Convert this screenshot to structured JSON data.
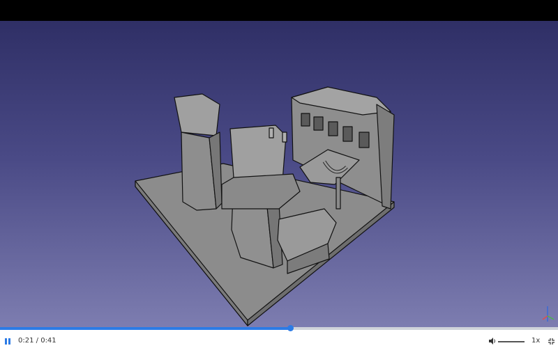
{
  "player": {
    "current_time": "0:21",
    "separator": " / ",
    "duration": "0:41",
    "progress": 0.52,
    "speed_label": "1x",
    "accent_color": "#2c7be5"
  },
  "icons": {
    "play_pause": "pause-icon",
    "volume": "volume-icon",
    "fullscreen": "exit-fullscreen-icon",
    "axis": "axis-cross-icon"
  },
  "colors": {
    "viewport_top": "#2f2f66",
    "viewport_bottom": "#7d7db0",
    "model_fill": "#8f8f8f"
  }
}
